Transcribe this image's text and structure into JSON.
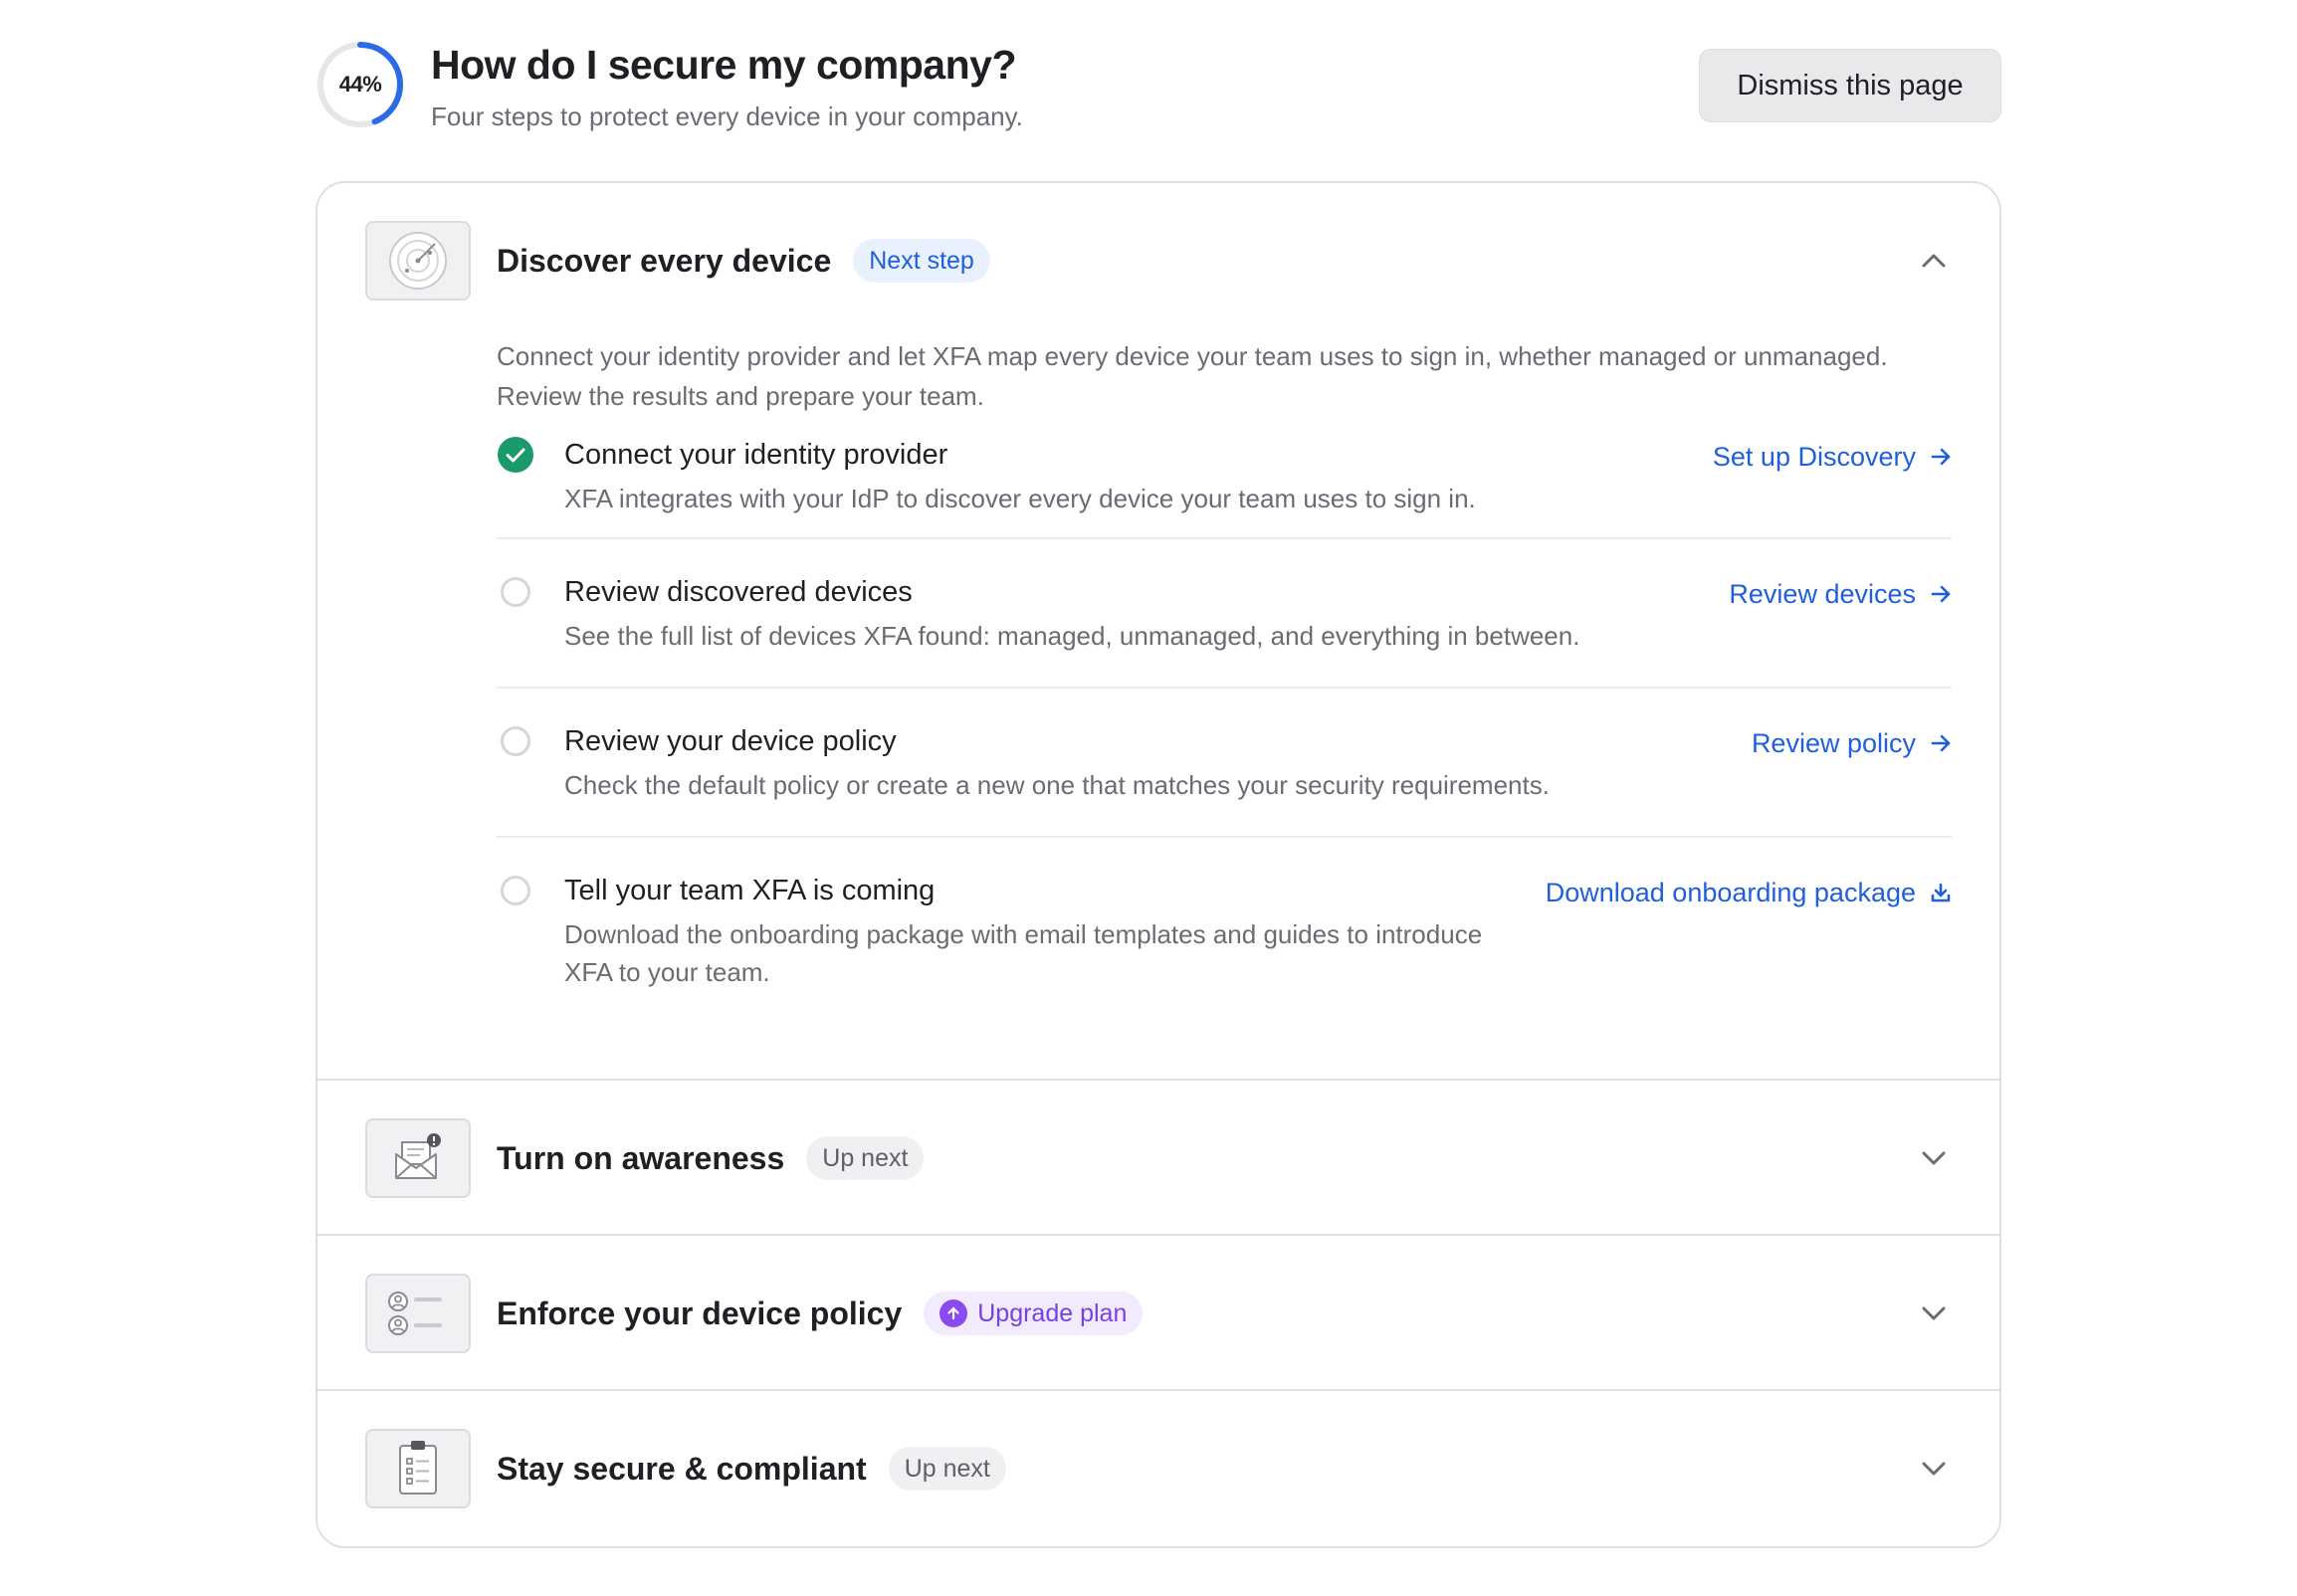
{
  "header": {
    "progress": "44%",
    "progress_value": 44,
    "title": "How do I secure my company?",
    "subtitle": "Four steps to protect every device in your company.",
    "dismiss_label": "Dismiss this page"
  },
  "colors": {
    "accent": "#1f5fdc",
    "success": "#1a9a6a",
    "upgrade": "#7a3fe0"
  },
  "sections": [
    {
      "title": "Discover every device",
      "badge": "Next step",
      "icon": "radar-icon",
      "expanded": true,
      "intro": "Connect your identity provider and let XFA map every device your team uses to sign in, whether managed or unmanaged. Review the results and prepare your team.",
      "steps": [
        {
          "title": "Connect your identity provider",
          "description": "XFA integrates with your IdP to discover every device your team uses to sign in.",
          "link": "Set up Discovery",
          "link_icon": "arrow-right-icon",
          "done": true
        },
        {
          "title": "Review discovered devices",
          "description": "See the full list of devices XFA found: managed, unmanaged, and everything in between.",
          "link": "Review devices",
          "link_icon": "arrow-right-icon",
          "done": false
        },
        {
          "title": "Review your device policy",
          "description": "Check the default policy or create a new one that matches your security requirements.",
          "link": "Review policy",
          "link_icon": "arrow-right-icon",
          "done": false
        },
        {
          "title": "Tell your team XFA is coming",
          "description_line1": "Download the onboarding package with email templates and guides to introduce",
          "description_line2": "XFA to your team.",
          "link": "Download onboarding package",
          "link_icon": "download-icon",
          "done": false
        }
      ]
    },
    {
      "title": "Turn on awareness",
      "badge": "Up next",
      "icon": "envelope-alert-icon",
      "expanded": false
    },
    {
      "title": "Enforce your device policy",
      "badge": "Upgrade plan",
      "icon": "user-list-icon",
      "expanded": false
    },
    {
      "title": "Stay secure & compliant",
      "badge": "Up next",
      "icon": "clipboard-checklist-icon",
      "expanded": false
    }
  ]
}
